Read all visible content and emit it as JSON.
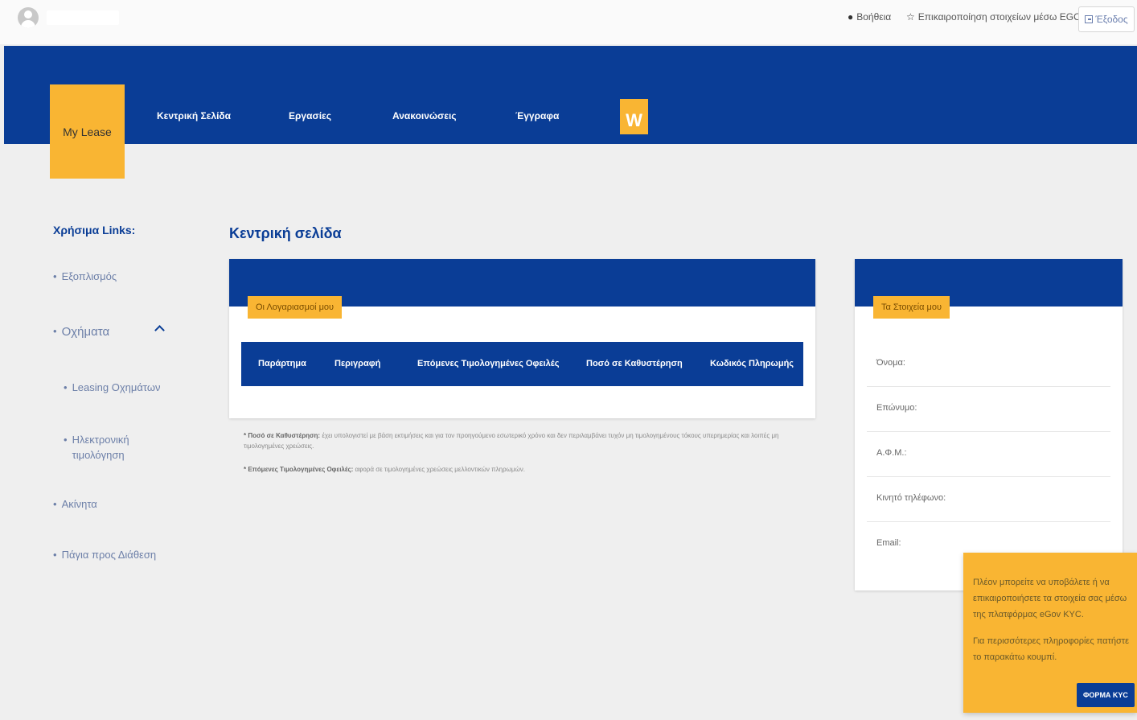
{
  "topbar": {
    "help_label": "Βοήθεια",
    "kyc_label": "Επικαιροποίηση στοιχείων μέσω EGOV",
    "logout_label": "Έξοδος"
  },
  "nav": {
    "brand": "My Lease",
    "items": [
      "Κεντρική Σελίδα",
      "Εργασίες",
      "Ανακοινώσεις",
      "Έγγραφα"
    ],
    "logo_letter": "W"
  },
  "sidebar": {
    "title": "Χρήσιμα Links:",
    "items": [
      "Εξοπλισμός",
      "Οχήματα",
      "Leasing Οχημάτων",
      "Ηλεκτρονική τιμολόγηση",
      "Ακίνητα",
      "Πάγια προς Διάθεση"
    ]
  },
  "main": {
    "title": "Κεντρική σελίδα",
    "tag": "Οι Λογαριασμοί μου",
    "columns": [
      "Παράρτημα",
      "Περιγραφή",
      "Επόμενες Τιμολογημένες Οφειλές",
      "Ποσό σε Καθυστέρηση",
      "Κωδικός Πληρωμής"
    ],
    "footnote1_bold": "* Ποσό σε Καθυστέρηση:",
    "footnote1_text": "έχει υπολογιστεί με βάση εκτιμήσεις και για τον προηγούμενο εσωτερικό χρόνο και δεν περιλαμβάνει τυχόν μη τιμολογημένους τόκους υπερημερίας και λοιπές μη τιμολογημένες χρεώσεις.",
    "footnote2_bold": "* Επόμενες Τιμολογημένες Οφειλές:",
    "footnote2_text": "αφορά σε τιμολογημένες χρεώσεις μελλοντικών πληρωμών."
  },
  "profile": {
    "tag": "Τα Στοιχεία μου",
    "fields": [
      "Όνομα:",
      "Επώνυμο:",
      "Α.Φ.Μ.:",
      "Κινητό τηλέφωνο:",
      "Email:"
    ]
  },
  "kyc_popup": {
    "text1": "Πλέον μπορείτε να υποβάλετε ή να επικαιροποιήσετε τα στοιχεία σας μέσω της πλατφόρμας eGov KYC.",
    "text2": "Για περισσότερες πληροφορίες πατήστε το παρακάτω κουμπί.",
    "button": "ΦΟΡΜΑ KYC"
  },
  "colors": {
    "primary": "#0a3d96",
    "accent": "#f9b533",
    "background": "#efefef"
  },
  "icons": [
    "user-avatar-icon",
    "help-circle-icon",
    "star-icon",
    "logout-icon",
    "chevron-up-icon"
  ]
}
